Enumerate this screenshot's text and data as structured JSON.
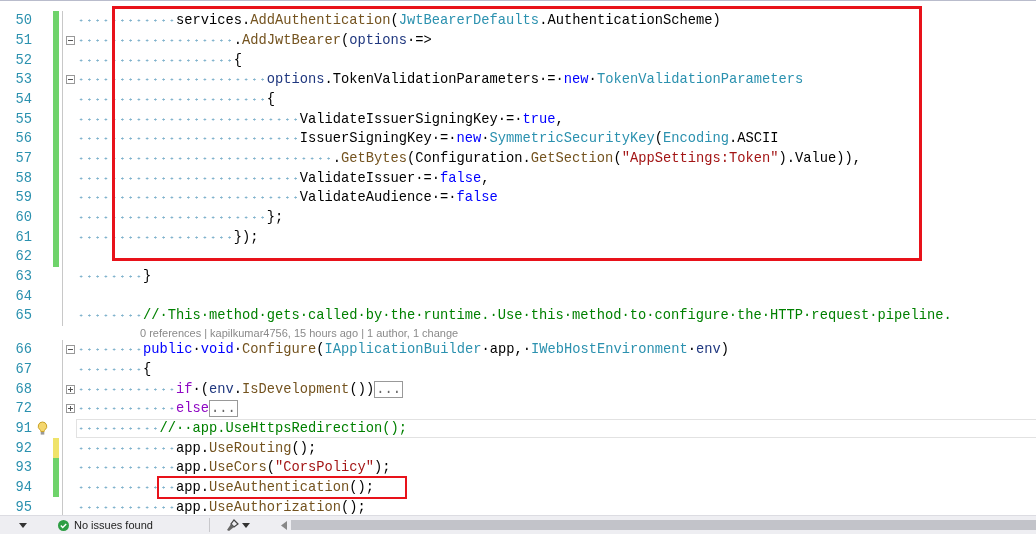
{
  "editor": {
    "blocks": [
      {
        "highlighted": true,
        "lines": [
          {
            "kind": "code",
            "number": "50",
            "modified": true,
            "unsaved": false,
            "foldable": false,
            "current": false,
            "lightbulb": false,
            "tokens": [
              {
                "kind": "p",
                "t": "            services."
              },
              {
                "kind": "me",
                "t": "AddAuthentication"
              },
              {
                "kind": "p",
                "t": "("
              },
              {
                "kind": "ty",
                "t": "JwtBearerDefaults"
              },
              {
                "kind": "p",
                "t": ".AuthenticationScheme)"
              }
            ]
          },
          {
            "kind": "code",
            "number": "51",
            "modified": true,
            "unsaved": false,
            "foldable": true,
            "collapsed": false,
            "current": false,
            "lightbulb": false,
            "tokens": [
              {
                "kind": "p",
                "t": "                   ."
              },
              {
                "kind": "me",
                "t": "AddJwtBearer"
              },
              {
                "kind": "p",
                "t": "("
              },
              {
                "kind": "va",
                "t": "options"
              },
              {
                "kind": "p",
                "t": "·=>"
              }
            ]
          },
          {
            "kind": "code",
            "number": "52",
            "modified": true,
            "unsaved": false,
            "foldable": false,
            "current": false,
            "lightbulb": false,
            "tokens": [
              {
                "kind": "p",
                "t": "                   {"
              }
            ]
          },
          {
            "kind": "code",
            "number": "53",
            "modified": true,
            "unsaved": false,
            "foldable": true,
            "collapsed": false,
            "current": false,
            "lightbulb": false,
            "tokens": [
              {
                "kind": "va",
                "t": "                       options"
              },
              {
                "kind": "p",
                "t": ".TokenValidationParameters·=·"
              },
              {
                "kind": "kw",
                "t": "new"
              },
              {
                "kind": "p",
                "t": "·"
              },
              {
                "kind": "ty",
                "t": "TokenValidationParameters"
              }
            ]
          },
          {
            "kind": "code",
            "number": "54",
            "modified": true,
            "unsaved": false,
            "foldable": false,
            "current": false,
            "lightbulb": false,
            "tokens": [
              {
                "kind": "p",
                "t": "                       {"
              }
            ]
          },
          {
            "kind": "code",
            "number": "55",
            "modified": true,
            "unsaved": false,
            "foldable": false,
            "current": false,
            "lightbulb": false,
            "tokens": [
              {
                "kind": "p",
                "t": "                           ValidateIssuerSigningKey·=·"
              },
              {
                "kind": "kw",
                "t": "true"
              },
              {
                "kind": "p",
                "t": ","
              }
            ]
          },
          {
            "kind": "code",
            "number": "56",
            "modified": true,
            "unsaved": false,
            "foldable": false,
            "current": false,
            "lightbulb": false,
            "tokens": [
              {
                "kind": "p",
                "t": "                           IssuerSigningKey·=·"
              },
              {
                "kind": "kw",
                "t": "new"
              },
              {
                "kind": "p",
                "t": "·"
              },
              {
                "kind": "ty",
                "t": "SymmetricSecurityKey"
              },
              {
                "kind": "p",
                "t": "("
              },
              {
                "kind": "ty",
                "t": "Encoding"
              },
              {
                "kind": "p",
                "t": ".ASCII"
              }
            ]
          },
          {
            "kind": "code",
            "number": "57",
            "modified": true,
            "unsaved": false,
            "foldable": false,
            "current": false,
            "lightbulb": false,
            "tokens": [
              {
                "kind": "p",
                "t": "                               ."
              },
              {
                "kind": "me",
                "t": "GetBytes"
              },
              {
                "kind": "p",
                "t": "(Configuration."
              },
              {
                "kind": "me",
                "t": "GetSection"
              },
              {
                "kind": "p",
                "t": "("
              },
              {
                "kind": "st",
                "t": "\"AppSettings:Token\""
              },
              {
                "kind": "p",
                "t": ").Value)),"
              }
            ]
          },
          {
            "kind": "code",
            "number": "58",
            "modified": true,
            "unsaved": false,
            "foldable": false,
            "current": false,
            "lightbulb": false,
            "tokens": [
              {
                "kind": "p",
                "t": "                           ValidateIssuer·=·"
              },
              {
                "kind": "kw",
                "t": "false"
              },
              {
                "kind": "p",
                "t": ","
              }
            ]
          },
          {
            "kind": "code",
            "number": "59",
            "modified": true,
            "unsaved": false,
            "foldable": false,
            "current": false,
            "lightbulb": false,
            "tokens": [
              {
                "kind": "p",
                "t": "                           ValidateAudience·=·"
              },
              {
                "kind": "kw",
                "t": "false"
              }
            ]
          },
          {
            "kind": "code",
            "number": "60",
            "modified": true,
            "unsaved": false,
            "foldable": false,
            "current": false,
            "lightbulb": false,
            "tokens": [
              {
                "kind": "p",
                "t": "                       };"
              }
            ]
          },
          {
            "kind": "code",
            "number": "61",
            "modified": true,
            "unsaved": false,
            "foldable": false,
            "current": false,
            "lightbulb": false,
            "tokens": [
              {
                "kind": "p",
                "t": "                   });"
              }
            ]
          },
          {
            "kind": "code",
            "number": "62",
            "modified": true,
            "unsaved": false,
            "foldable": false,
            "current": false,
            "lightbulb": false
          }
        ]
      },
      {
        "highlighted": false,
        "lines": [
          {
            "kind": "code",
            "number": "63",
            "modified": false,
            "foldable": false,
            "current": false,
            "lightbulb": false,
            "tokens": [
              {
                "kind": "p",
                "t": "        }"
              }
            ]
          },
          {
            "kind": "code",
            "number": "64",
            "modified": false,
            "foldable": false,
            "current": false,
            "lightbulb": false
          },
          {
            "kind": "code",
            "number": "65",
            "modified": false,
            "foldable": false,
            "current": false,
            "lightbulb": false,
            "tokens": [
              {
                "kind": "cm",
                "t": "        //·This·method·gets·called·by·the·runtime.·Use·this·method·to·configure·the·HTTP·request·pipeline."
              }
            ]
          },
          {
            "kind": "codelens",
            "text": "0 references | kapilkumar4756, 15 hours ago | 1 author, 1 change"
          },
          {
            "kind": "code",
            "number": "66",
            "modified": false,
            "foldable": true,
            "collapsed": false,
            "current": false,
            "lightbulb": false,
            "tokens": [
              {
                "kind": "kw",
                "t": "        public"
              },
              {
                "kind": "p",
                "t": "·"
              },
              {
                "kind": "kw",
                "t": "void"
              },
              {
                "kind": "p",
                "t": "·"
              },
              {
                "kind": "me",
                "t": "Configure"
              },
              {
                "kind": "p",
                "t": "("
              },
              {
                "kind": "ty",
                "t": "IApplicationBuilder"
              },
              {
                "kind": "p",
                "t": "·app,·"
              },
              {
                "kind": "ty",
                "t": "IWebHostEnvironment"
              },
              {
                "kind": "p",
                "t": "·"
              },
              {
                "kind": "va",
                "t": "env"
              },
              {
                "kind": "p",
                "t": ")"
              }
            ]
          },
          {
            "kind": "code",
            "number": "67",
            "modified": false,
            "foldable": false,
            "current": false,
            "lightbulb": false,
            "tokens": [
              {
                "kind": "p",
                "t": "        {"
              }
            ]
          },
          {
            "kind": "code",
            "number": "68",
            "modified": false,
            "foldable": true,
            "collapsed": true,
            "current": false,
            "lightbulb": false,
            "tokens": [
              {
                "kind": "ctl",
                "t": "            if"
              },
              {
                "kind": "p",
                "t": "·("
              },
              {
                "kind": "va",
                "t": "env"
              },
              {
                "kind": "p",
                "t": "."
              },
              {
                "kind": "me",
                "t": "IsDevelopment"
              },
              {
                "kind": "p",
                "t": "())"
              },
              {
                "kind": "col",
                "t": "..."
              }
            ]
          },
          {
            "kind": "code",
            "number": "72",
            "modified": false,
            "foldable": true,
            "collapsed": true,
            "current": false,
            "lightbulb": false,
            "tokens": [
              {
                "kind": "ctl",
                "t": "            else"
              },
              {
                "kind": "col",
                "t": "..."
              }
            ]
          },
          {
            "kind": "code",
            "number": "91",
            "modified": false,
            "foldable": false,
            "current": true,
            "lightbulb": true,
            "tokens": [
              {
                "kind": "cm",
                "t": "          //··app.UseHttpsRedirection();"
              }
            ]
          },
          {
            "kind": "code",
            "number": "92",
            "modified": true,
            "unsaved": true,
            "foldable": false,
            "current": false,
            "lightbulb": false,
            "tokens": [
              {
                "kind": "p",
                "t": "            app."
              },
              {
                "kind": "me",
                "t": "UseRouting"
              },
              {
                "kind": "p",
                "t": "();"
              }
            ]
          },
          {
            "kind": "code",
            "number": "93",
            "modified": true,
            "unsaved": false,
            "foldable": false,
            "current": false,
            "lightbulb": false,
            "tokens": [
              {
                "kind": "p",
                "t": "            app."
              },
              {
                "kind": "me",
                "t": "UseCors"
              },
              {
                "kind": "p",
                "t": "("
              },
              {
                "kind": "st",
                "t": "\"CorsPolicy\""
              },
              {
                "kind": "p",
                "t": ");"
              }
            ]
          }
        ]
      },
      {
        "highlighted": true,
        "lines": [
          {
            "kind": "code",
            "number": "94",
            "modified": true,
            "unsaved": false,
            "foldable": false,
            "current": false,
            "lightbulb": false,
            "tokens": [
              {
                "kind": "p",
                "t": "            app."
              },
              {
                "kind": "me",
                "t": "UseAuthentication"
              },
              {
                "kind": "p",
                "t": "();"
              }
            ]
          }
        ]
      },
      {
        "highlighted": false,
        "lines": [
          {
            "kind": "code",
            "number": "95",
            "modified": false,
            "foldable": false,
            "current": false,
            "lightbulb": false,
            "tokens": [
              {
                "kind": "p",
                "t": "            app."
              },
              {
                "kind": "me",
                "t": "UseAuthorization"
              },
              {
                "kind": "p",
                "t": "();"
              }
            ]
          }
        ]
      }
    ]
  },
  "status_bar": {
    "message": "No issues found"
  }
}
